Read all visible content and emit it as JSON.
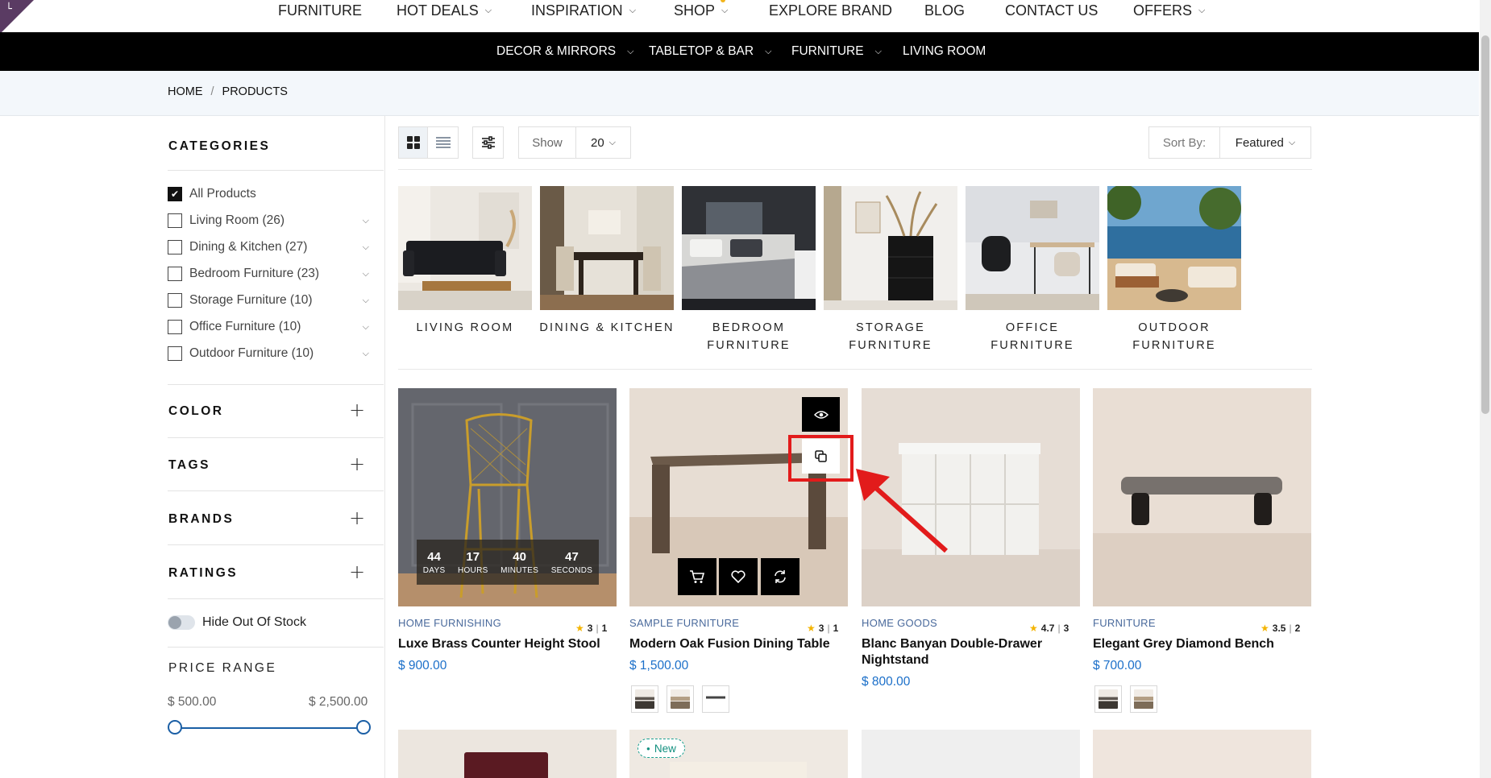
{
  "top_nav": {
    "items": [
      {
        "label": "FURNITURE",
        "dropdown": false
      },
      {
        "label": "HOT DEALS",
        "dropdown": true
      },
      {
        "label": "INSPIRATION",
        "dropdown": true
      },
      {
        "label": "SHOP",
        "dropdown": true
      },
      {
        "label": "EXPLORE BRAND",
        "dropdown": false
      },
      {
        "label": "BLOG",
        "dropdown": false
      },
      {
        "label": "CONTACT US",
        "dropdown": false
      },
      {
        "label": "OFFERS",
        "dropdown": true
      }
    ]
  },
  "sub_nav": {
    "items": [
      {
        "label": "DECOR & MIRRORS",
        "dropdown": true
      },
      {
        "label": "TABLETOP & BAR",
        "dropdown": true
      },
      {
        "label": "FURNITURE",
        "dropdown": true
      },
      {
        "label": "LIVING ROOM",
        "dropdown": false
      }
    ]
  },
  "breadcrumb": {
    "home": "HOME",
    "separator": "/",
    "current": "PRODUCTS"
  },
  "sidebar": {
    "categories_title": "CATEGORIES",
    "categories": [
      {
        "label": "All Products",
        "checked": true
      },
      {
        "label": "Living Room (26)",
        "checked": false
      },
      {
        "label": "Dining & Kitchen (27)",
        "checked": false
      },
      {
        "label": "Bedroom Furniture (23)",
        "checked": false
      },
      {
        "label": "Storage Furniture (10)",
        "checked": false
      },
      {
        "label": "Office Furniture (10)",
        "checked": false
      },
      {
        "label": "Outdoor Furniture (10)",
        "checked": false
      }
    ],
    "filters": [
      "COLOR",
      "TAGS",
      "BRANDS",
      "RATINGS"
    ],
    "hide_out_of_stock": "Hide Out Of Stock",
    "price_range": {
      "title": "PRICE RANGE",
      "min": "$ 500.00",
      "max": "$ 2,500.00"
    }
  },
  "toolbar": {
    "show_label": "Show",
    "show_value": "20",
    "sort_label": "Sort By:",
    "sort_value": "Featured"
  },
  "category_tiles": [
    {
      "label": "LIVING ROOM"
    },
    {
      "label": "DINING & KITCHEN"
    },
    {
      "label": "BEDROOM FURNITURE"
    },
    {
      "label": "STORAGE FURNITURE"
    },
    {
      "label": "OFFICE FURNITURE"
    },
    {
      "label": "OUTDOOR FURNITURE"
    }
  ],
  "products": [
    {
      "category": "HOME FURNISHING",
      "rating": "3",
      "reviews": "1",
      "name": "Luxe Brass Counter Height Stool",
      "price": "$ 900.00"
    },
    {
      "category": "SAMPLE FURNITURE",
      "rating": "3",
      "reviews": "1",
      "name": "Modern Oak Fusion Dining Table",
      "price": "$ 1,500.00"
    },
    {
      "category": "HOME GOODS",
      "rating": "4.7",
      "reviews": "3",
      "name": "Blanc Banyan Double-Drawer Nightstand",
      "price": "$ 800.00"
    },
    {
      "category": "FURNITURE",
      "rating": "3.5",
      "reviews": "2",
      "name": "Elegant Grey Diamond Bench",
      "price": "$ 700.00"
    }
  ],
  "countdown": [
    {
      "value": "44",
      "unit": "DAYS"
    },
    {
      "value": "17",
      "unit": "HOURS"
    },
    {
      "value": "40",
      "unit": "MINUTES"
    },
    {
      "value": "47",
      "unit": "SECONDS"
    }
  ],
  "new_badge": "New",
  "colors": {
    "accent_blue": "#1b6fc9",
    "highlight_red": "#e21b1b",
    "star": "#f4b400",
    "nav_black": "#000000"
  },
  "icons": [
    "eye-icon",
    "compare-copy-icon",
    "cart-icon",
    "heart-icon",
    "refresh-icon",
    "grid-view-icon",
    "list-view-icon",
    "filter-sliders-icon"
  ]
}
